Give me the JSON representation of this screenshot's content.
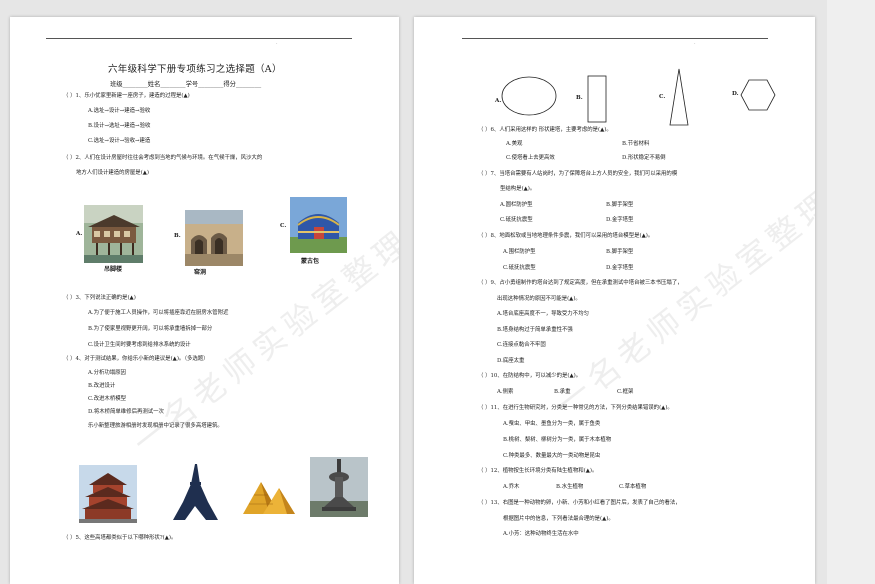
{
  "left": {
    "title": "六年级科学下册专项练习之选择题（A）",
    "info": "班级________姓名________学号________得分________",
    "lines": [
      "（      ）1、乐小优家里新建一座房子，建造的过程是(▲)",
      "A.选址→设计→建造→验收",
      "B.设计→选址→建造→验收",
      "C.选址→设计→验收→建造",
      "（      ）2、人们在设计房屋时往往会考虑到当地的气候与环境。在气候干燥，风沙大的",
      "地方人们设计建造的房屋是(▲)"
    ],
    "houses": {
      "a_label": "A.",
      "b_label": "B.",
      "c_label": "C.",
      "a_caption": "吊脚楼",
      "b_caption": "窑洞",
      "c_caption": "蒙古包"
    },
    "lines2": [
      "（      ）3、下列说法正确的是(▲)",
      "A.为了便于施工人员操作，可以将插座靠近在厨房水管附近",
      "B.为了使家里视野更开阔，可以将承重墙拆掉一部分",
      "C.设计卫生间时要考虑到给排水系统的设计",
      "（      ）4、对于测试结果，你给乐小新的建议是(▲)。（多选题）",
      "A.分析功塌原因",
      "B.改进设计",
      "C.改进木桥模型",
      "D.将木桥简单维修后再测试一次",
      "乐小新整理旅游相册时发现相册中记录了很多高塔建筑。"
    ],
    "q5": "（      ）5、这些高塔都类似于以下哪种形状?(▲)。",
    "watermark": "一名老师实验室整理"
  },
  "right": {
    "shape_labels": [
      "A.",
      "B.",
      "C.",
      "D."
    ],
    "lines": [
      "（      ）6、人们采用这样的                         形状建塔，主要考虑的是(▲)。",
      "A.美观",
      "B.节省材料",
      "C.使塔看上去更高效",
      "D.形状稳定不易倒",
      "（      ）7、当塔台需要有人站岗时，为了保障塔台上方人员的安全，我们可以采用的模",
      "型结构是(▲)。",
      "A.圆栏防护型",
      "B.脚手架型",
      "C.砥抚抗震型",
      "D.金字塔型",
      "（      ）8、地面松软或当地地理条件多震，我们可以采用的塔台模型是(▲)。",
      "A.围栏防护型",
      "B.脚手架型",
      "C.砥抚抗震型",
      "D.金字塔型",
      "（      ）9、占小勇组制作的塔台达到了规定高度，但在承重测试中塔台被三本书压塌了，",
      "出现这种情况的原因不可能是(▲)。",
      "A.塔台底座高度不一，导致受力不均匀",
      "B.塔身结构过于简单承重性不强",
      "C.连接点黏合不牢固",
      "D.底座太重",
      "（      ）10、在防结构中，可以减少的是(▲)。",
      "A.侧索",
      "B.承重",
      "C.框架",
      "（      ）11、在进行生物研究时，分类是一种常见的方法，下列分类结果错误的(▲)。",
      "A.蚕虫、甲虫、墨鱼分为一类，属于鱼类",
      "B.桃树、梨树、柳树分为一类，属于木本植物",
      "C.种类最多、数量最大的一类动物是昆虫",
      "（      ）12、植物按生长环境分类有陆生植物和(▲)。",
      "A.乔木",
      "B.水生植物",
      "C.草本植物",
      "（      ）13、右图是一种动物的卵，小新、小芳和小红看了图片后，发表了自己的看法，",
      "根据图片中的信息，下列看法最合理的是(▲)。",
      "A.小芳：这种动物终生活在水中"
    ],
    "watermark": "一名老师实验室整理"
  }
}
